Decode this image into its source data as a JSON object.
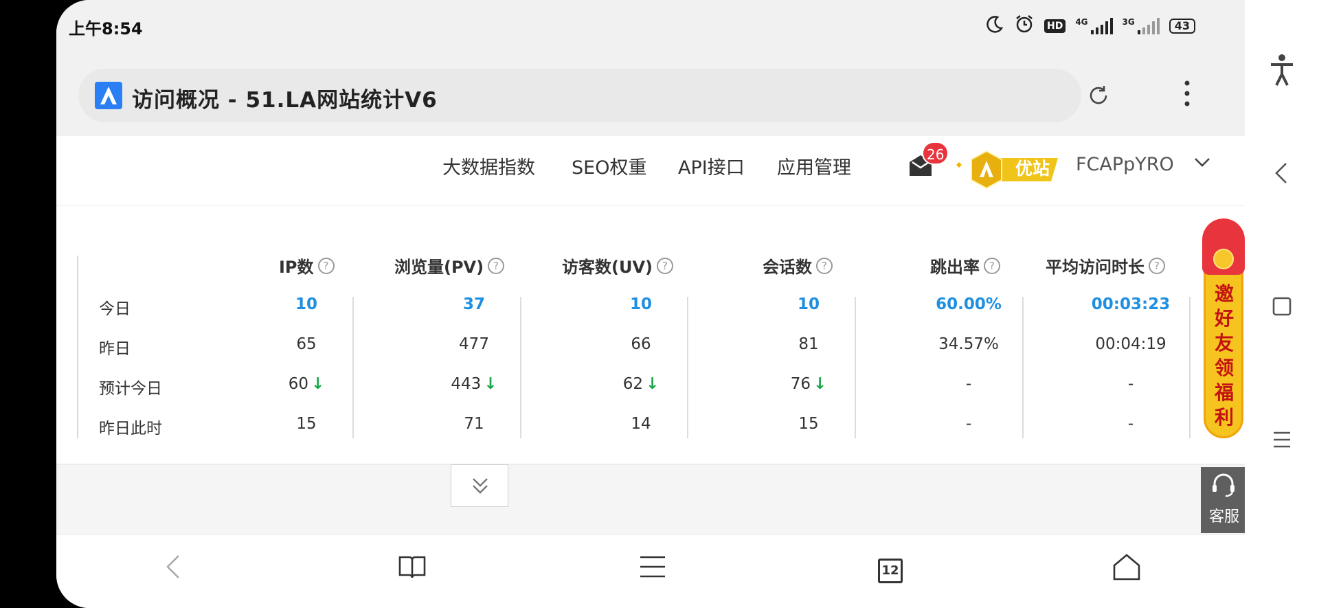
{
  "status_bar": {
    "time": "上午8:54",
    "icons": [
      "moon-icon",
      "alarm-icon",
      "hd-icon",
      "signal-4g-icon",
      "signal-3g-icon"
    ],
    "net_4g": "4G",
    "net_3g": "3G",
    "hd": "HD",
    "battery": "43"
  },
  "browser": {
    "title": "访问概况 - 51.LA网站统计V6",
    "favicon_color": "#2a7ff5"
  },
  "nav": {
    "items": [
      "大数据指数",
      "SEO权重",
      "API接口",
      "应用管理"
    ],
    "mail_badge": "26",
    "vip_label": "优站",
    "username": "FCAPpYRO"
  },
  "stats": {
    "headers": [
      "IP数",
      "浏览量(PV)",
      "访客数(UV)",
      "会话数",
      "跳出率",
      "平均访问时长"
    ],
    "rows": [
      {
        "label": "今日",
        "values": [
          "10",
          "37",
          "10",
          "10",
          "60.00%",
          "00:03:23"
        ]
      },
      {
        "label": "昨日",
        "values": [
          "65",
          "477",
          "66",
          "81",
          "34.57%",
          "00:04:19"
        ]
      },
      {
        "label": "预计今日",
        "values": [
          "60",
          "443",
          "62",
          "76",
          "-",
          "-"
        ]
      },
      {
        "label": "昨日此时",
        "values": [
          "15",
          "71",
          "14",
          "15",
          "-",
          "-"
        ]
      }
    ],
    "down_arrow": "↓",
    "help_glyph": "?",
    "colors": {
      "today": "#1e8fe1",
      "down": "#1aa84a"
    }
  },
  "promo": {
    "text": "邀好友领福利"
  },
  "customer_service": {
    "label": "客服"
  },
  "bottom_bar": {
    "tab_count": "12"
  }
}
